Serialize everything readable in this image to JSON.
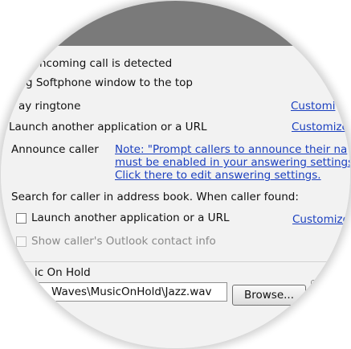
{
  "incoming": {
    "header_label": "ncoming call is detected",
    "bring_to_top": "g Softphone window to the top",
    "play_ringtone": "ay ringtone",
    "play_ringtone_link": "Customi",
    "launch_app": "Launch another application or a URL",
    "launch_app_link": "Customize",
    "announce_caller": "Announce caller",
    "note_line1": "Note: \"Prompt callers to announce their na",
    "note_line2": "must be enabled in your answering settings",
    "note_line3": "Click there to edit answering settings."
  },
  "caller_lookup": {
    "label": "Search for caller in address book. When caller found:",
    "launch_app": "Launch another application or a URL",
    "launch_app_link": "Customize",
    "outlook_contact": "Show caller's Outlook contact info"
  },
  "music_on_hold": {
    "label": "ic On Hold",
    "path_value": "Waves\\MusicOnHold\\Jazz.wav",
    "browse_label": "Browse..."
  }
}
